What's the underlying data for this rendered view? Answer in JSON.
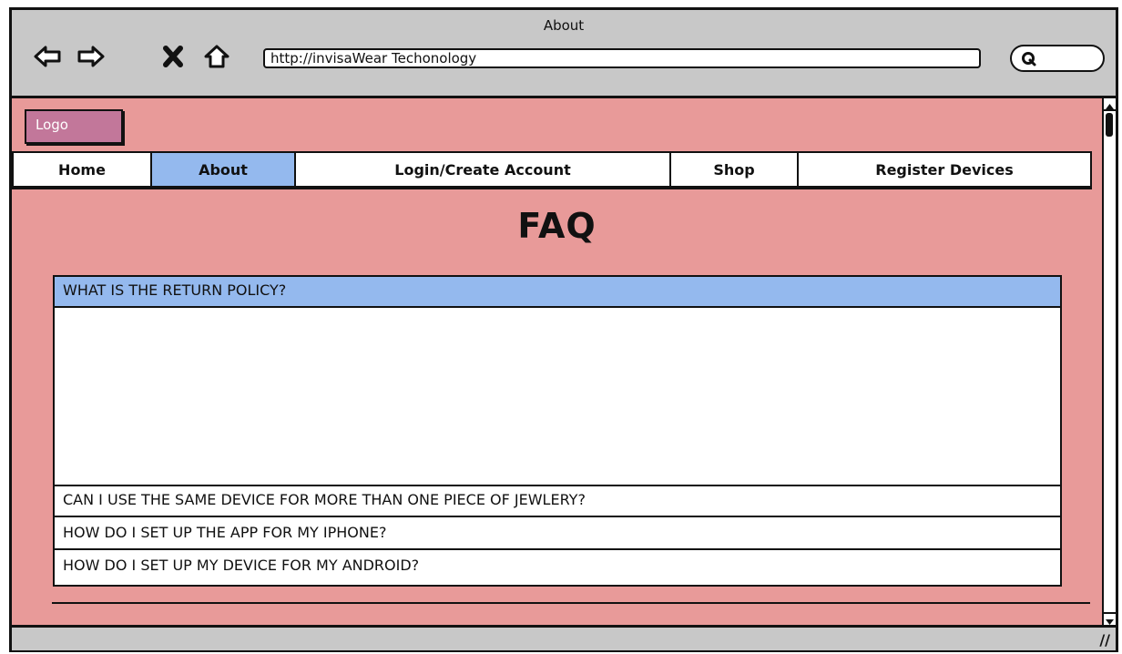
{
  "window": {
    "title": "About"
  },
  "browser": {
    "url": "http://invisaWear Techonology",
    "back_icon": "left-arrow-icon",
    "forward_icon": "right-arrow-icon",
    "stop_icon": "close-icon",
    "home_icon": "home-icon",
    "search_icon": "search-icon"
  },
  "header": {
    "logo": "Logo"
  },
  "nav": {
    "items": [
      {
        "label": "Home"
      },
      {
        "label": "About",
        "active": true
      },
      {
        "label": "Login/Create Account"
      },
      {
        "label": "Shop"
      },
      {
        "label": "Register Devices"
      }
    ]
  },
  "main": {
    "title": "FAQ",
    "faqs": [
      {
        "question": "WHAT IS THE RETURN POLICY?",
        "expanded": true
      },
      {
        "question": "CAN I USE THE SAME DEVICE FOR MORE THAN ONE PIECE OF JEWLERY?"
      },
      {
        "question": "HOW DO I SET UP THE APP FOR MY IPHONE?"
      },
      {
        "question": "HOW DO I SET UP MY DEVICE FOR MY ANDROID?"
      }
    ]
  },
  "colors": {
    "page_background": "#e89a99",
    "logo_background": "#c2779a",
    "active_accent": "#94b9ee",
    "chrome": "#c8c8c8"
  }
}
